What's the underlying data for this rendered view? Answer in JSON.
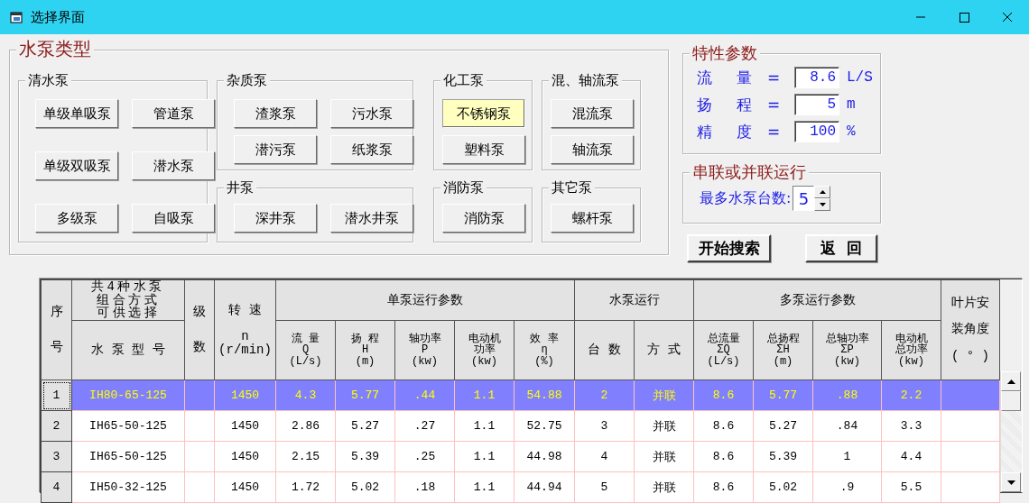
{
  "window": {
    "title": "选择界面"
  },
  "pump_types": {
    "title": "水泵类型",
    "groups": [
      {
        "kind": "tall",
        "title": "清水泵",
        "buttons": [
          {
            "label": "单级单吸泵",
            "selected": false
          },
          {
            "label": "管道泵",
            "selected": false
          },
          {
            "label": "单级双吸泵",
            "selected": false
          },
          {
            "label": "潜水泵",
            "selected": false
          },
          {
            "label": "多级泵",
            "selected": false
          },
          {
            "label": "自吸泵",
            "selected": false
          }
        ]
      },
      {
        "kind": "wide",
        "title": "杂质泵",
        "buttons": [
          {
            "label": "渣浆泵",
            "selected": false
          },
          {
            "label": "污水泵",
            "selected": false
          },
          {
            "label": "潜污泵",
            "selected": false
          },
          {
            "label": "纸浆泵",
            "selected": false
          }
        ]
      },
      {
        "kind": "wide",
        "title": "井泵",
        "buttons": [
          {
            "label": "深井泵",
            "selected": false
          },
          {
            "label": "潜水井泵",
            "selected": false
          }
        ]
      },
      {
        "kind": "narrow",
        "title": "化工泵",
        "buttons": [
          {
            "label": "不锈钢泵",
            "selected": true
          },
          {
            "label": "塑料泵",
            "selected": false
          }
        ]
      },
      {
        "kind": "narrow",
        "title": "消防泵",
        "buttons": [
          {
            "label": "消防泵",
            "selected": false
          }
        ]
      },
      {
        "kind": "narrow",
        "title": "混、轴流泵",
        "buttons": [
          {
            "label": "混流泵",
            "selected": false
          },
          {
            "label": "轴流泵",
            "selected": false
          }
        ]
      },
      {
        "kind": "narrow",
        "title": "其它泵",
        "buttons": [
          {
            "label": "螺杆泵",
            "selected": false
          }
        ]
      }
    ]
  },
  "parameters": {
    "title": "特性参数",
    "rows": [
      {
        "label": "流 量",
        "sign": "=",
        "value": "8.6",
        "unit": "L/S"
      },
      {
        "label": "扬 程",
        "sign": "=",
        "value": "5",
        "unit": "m"
      },
      {
        "label": "精 度",
        "sign": "=",
        "value": "100",
        "unit": "%"
      }
    ]
  },
  "operation": {
    "title": "串联或并联运行",
    "label": "最多水泵台数:",
    "value": "5"
  },
  "actions": [
    "开始搜索",
    "返  回"
  ],
  "table": {
    "header": [
      "序号",
      "共4种水泵组合方式可供选择",
      "级数",
      "转  速\n\nn\n(r/min)",
      "单泵运行参数",
      "水泵运行",
      "多泵运行参数",
      "叶片安装角度( ° )",
      "水 泵 型 号",
      "流  量\nQ\n(L/s)",
      "扬  程\nH\n(m)",
      "轴功率\nP\n(kw)",
      "电动机功率\n(kw)",
      "效  率\nη\n(%)",
      "台  数",
      "方  式",
      "总流量\nΣQ\n(L/s)",
      "总扬程\nΣH\n(m)",
      "总轴功率\nΣP\n(kw)",
      "电动机总功率\n(kw)"
    ],
    "rows": [
      {
        "selected": true,
        "cells": [
          "1",
          "IH80-65-125",
          "1450",
          "4.3",
          "5.77",
          ".44",
          "1.1",
          "54.88",
          "2",
          "并联",
          "8.6",
          "5.77",
          ".88",
          "2.2"
        ]
      },
      {
        "selected": false,
        "cells": [
          "2",
          "IH65-50-125",
          "1450",
          "2.86",
          "5.27",
          ".27",
          "1.1",
          "52.75",
          "3",
          "并联",
          "8.6",
          "5.27",
          ".84",
          "3.3"
        ]
      },
      {
        "selected": false,
        "cells": [
          "3",
          "IH65-50-125",
          "1450",
          "2.15",
          "5.39",
          ".25",
          "1.1",
          "44.98",
          "4",
          "并联",
          "8.6",
          "5.39",
          "1",
          "4.4"
        ]
      },
      {
        "selected": false,
        "cells": [
          "4",
          "IH50-32-125",
          "1450",
          "1.72",
          "5.02",
          ".18",
          "1.1",
          "44.94",
          "5",
          "并联",
          "8.6",
          "5.02",
          ".9",
          "5.5"
        ]
      }
    ]
  }
}
